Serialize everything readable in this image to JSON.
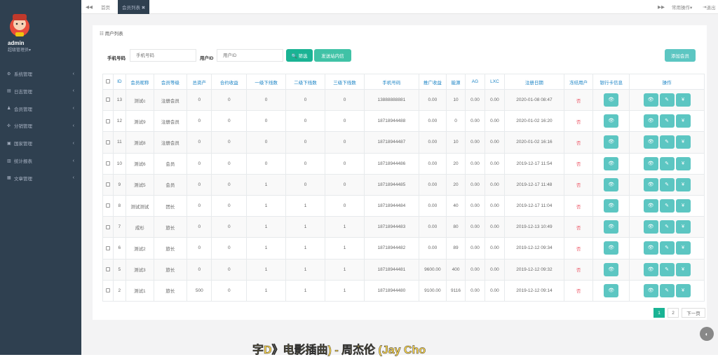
{
  "user": {
    "name": "admin",
    "role": "超级管理员▾"
  },
  "nav": [
    {
      "label": "系统管理",
      "icon": "gear-icon",
      "glyph": "⚙"
    },
    {
      "label": "日志管理",
      "icon": "list-icon",
      "glyph": "▤"
    },
    {
      "label": "会员管理",
      "icon": "users-icon",
      "glyph": "♟"
    },
    {
      "label": "分销管理",
      "icon": "share-icon",
      "glyph": "✣"
    },
    {
      "label": "国家管理",
      "icon": "flag-icon",
      "glyph": "▣"
    },
    {
      "label": "统计报表",
      "icon": "chart-icon",
      "glyph": "▥"
    },
    {
      "label": "文章管理",
      "icon": "doc-icon",
      "glyph": "▦"
    }
  ],
  "tabs": {
    "back": "◀◀",
    "home": "首页",
    "active": "会员列表 ✖",
    "forward": "▶▶",
    "ops": "常用操作▾",
    "logout": "退出"
  },
  "panel_title": "☷ 用户列表",
  "filters": {
    "phone_label": "手机号码",
    "phone_placeholder": "手机号码",
    "uid_label": "用户ID",
    "uid_placeholder": "用户ID",
    "search_btn": "🔍 筛选",
    "send_btn": "发送站内信",
    "add_btn": "添加会员"
  },
  "columns": [
    "",
    "ID",
    "会员昵称",
    "会员等级",
    "总资产",
    "合约收益",
    "一级下线数",
    "二级下线数",
    "三级下线数",
    "手机号码",
    "推广收益",
    "能源",
    "AG",
    "LXC",
    "注册日期",
    "冻结用户",
    "银行卡信息",
    "操作"
  ],
  "rows": [
    [
      "13",
      "测试c",
      "注册会员",
      "0",
      "0",
      "0",
      "0",
      "0",
      "13888888881",
      "0.00",
      "10",
      "0.00",
      "0.00",
      "2020-01-08 08:47",
      "否"
    ],
    [
      "12",
      "测试9",
      "注册会员",
      "0",
      "0",
      "0",
      "0",
      "0",
      "18718944488",
      "0.00",
      "0",
      "0.00",
      "0.00",
      "2020-01-02 16:20",
      "否"
    ],
    [
      "11",
      "测试8",
      "注册会员",
      "0",
      "0",
      "0",
      "0",
      "0",
      "18718944487",
      "0.00",
      "10",
      "0.00",
      "0.00",
      "2020-01-02 16:16",
      "否"
    ],
    [
      "10",
      "测试6",
      "会员",
      "0",
      "0",
      "0",
      "0",
      "0",
      "18718944486",
      "0.00",
      "20",
      "0.00",
      "0.00",
      "2019-12-17 11:54",
      "否"
    ],
    [
      "9",
      "测试5",
      "会员",
      "0",
      "0",
      "1",
      "0",
      "0",
      "18718944485",
      "0.00",
      "20",
      "0.00",
      "0.00",
      "2019-12-17 11:48",
      "否"
    ],
    [
      "8",
      "测试测试",
      "团长",
      "0",
      "0",
      "1",
      "1",
      "0",
      "18718944484",
      "0.00",
      "40",
      "0.00",
      "0.00",
      "2019-12-17 11:04",
      "否"
    ],
    [
      "7",
      "成杉",
      "旅长",
      "0",
      "0",
      "1",
      "1",
      "1",
      "18718944483",
      "0.00",
      "80",
      "0.00",
      "0.00",
      "2019-12-13 10:49",
      "否"
    ],
    [
      "6",
      "测试2",
      "旅长",
      "0",
      "0",
      "1",
      "1",
      "1",
      "18718944482",
      "0.00",
      "89",
      "0.00",
      "0.00",
      "2019-12-12 09:34",
      "否"
    ],
    [
      "5",
      "测试3",
      "旅长",
      "0",
      "0",
      "1",
      "1",
      "1",
      "18718944481",
      "9600.00",
      "400",
      "0.00",
      "0.00",
      "2019-12-12 09:32",
      "否"
    ],
    [
      "2",
      "测试1",
      "旅长",
      "500",
      "0",
      "1",
      "1",
      "1",
      "18718944480",
      "9100.00",
      "9116",
      "0.00",
      "0.00",
      "2019-12-12 09:14",
      "否"
    ]
  ],
  "action_glyphs": {
    "view": "👁",
    "edit": "✎",
    "money": "¥"
  },
  "pagination": {
    "p1": "1",
    "p2": "2",
    "next": "下一页"
  },
  "subtitle": "字D》电影插曲) - 周杰伦 (Jay Cho"
}
